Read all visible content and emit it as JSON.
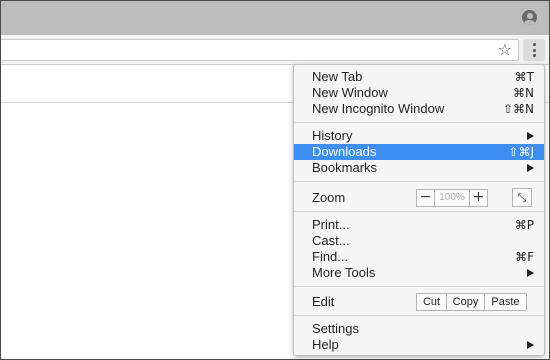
{
  "browser": {
    "profile_icon": "person-circle-icon",
    "bookmark_icon": "star-outline-icon",
    "menu_icon": "three-dots-vertical-icon"
  },
  "menu": {
    "highlight_color": "#3d8ef0",
    "items": [
      {
        "label": "New Tab",
        "shortcut": "⌘T"
      },
      {
        "label": "New Window",
        "shortcut": "⌘N"
      },
      {
        "label": "New Incognito Window",
        "shortcut": "⇧⌘N"
      },
      {
        "label": "History",
        "submenu": true
      },
      {
        "label": "Downloads",
        "shortcut": "⇧⌘J",
        "highlighted": true
      },
      {
        "label": "Bookmarks",
        "submenu": true
      },
      {
        "label": "Print...",
        "shortcut": "⌘P"
      },
      {
        "label": "Cast..."
      },
      {
        "label": "Find...",
        "shortcut": "⌘F"
      },
      {
        "label": "More Tools",
        "submenu": true
      },
      {
        "label": "Settings"
      },
      {
        "label": "Help",
        "submenu": true
      }
    ],
    "zoom": {
      "label": "Zoom",
      "minus": "−",
      "value": "100%",
      "plus": "+",
      "fullscreen": "⤡"
    },
    "edit": {
      "label": "Edit",
      "cut": "Cut",
      "copy": "Copy",
      "paste": "Paste"
    }
  }
}
